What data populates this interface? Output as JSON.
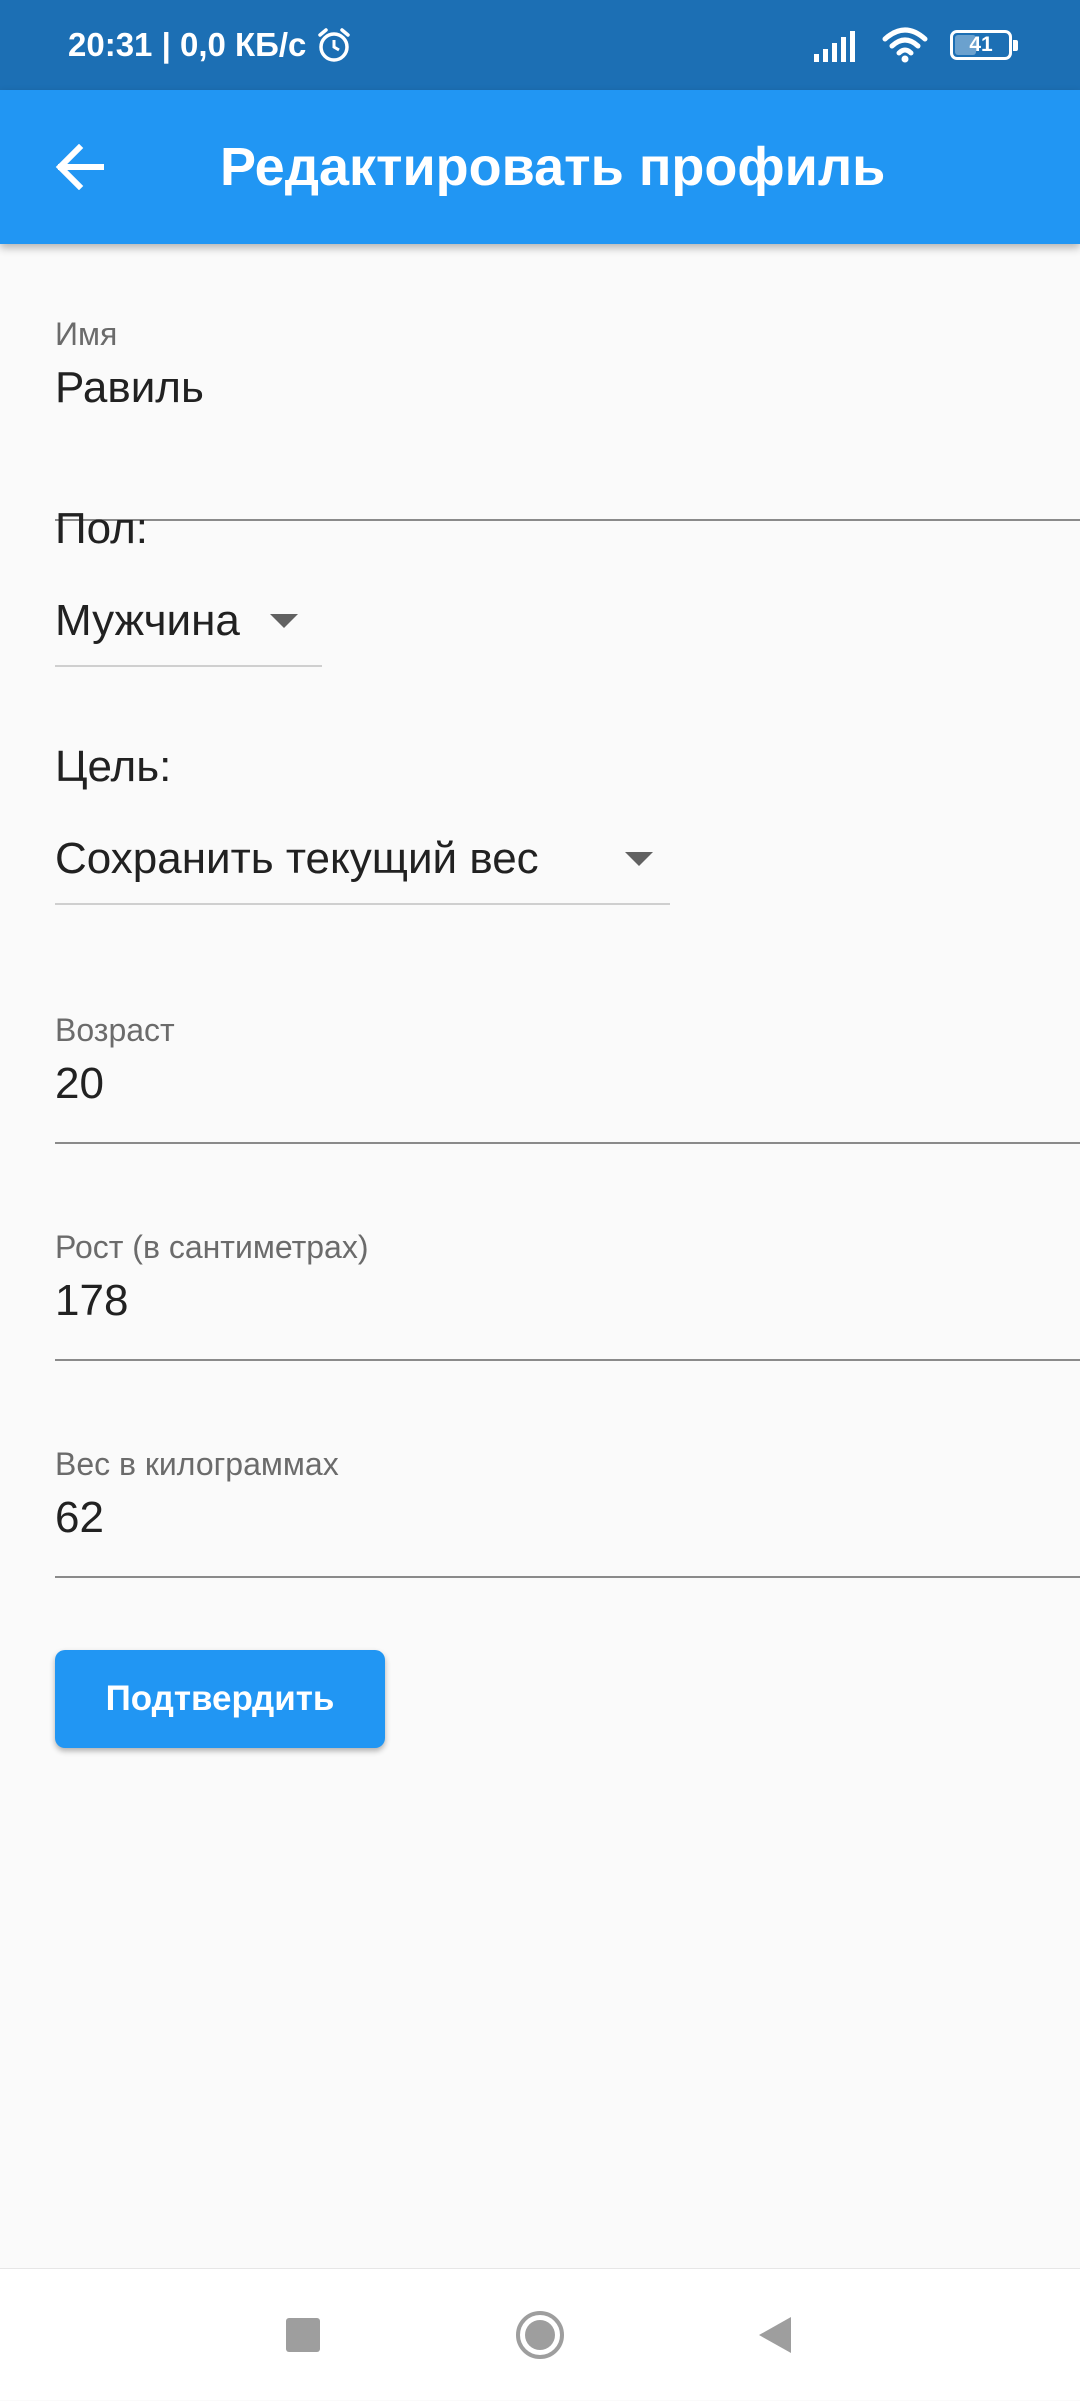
{
  "status_bar": {
    "time_speed": "20:31 | 0,0 КБ/с",
    "battery_level": "41",
    "battery_fraction": 0.41,
    "icons": [
      "alarm-icon",
      "signal-icon",
      "wifi-icon",
      "battery-icon"
    ]
  },
  "app_bar": {
    "title": "Редактировать профиль",
    "back_icon": "arrow-back-icon",
    "color": "#2196f3"
  },
  "form": {
    "name": {
      "label": "Имя",
      "value": "Равиль"
    },
    "gender": {
      "label": "Пол:",
      "value": "Мужчина"
    },
    "goal": {
      "label": "Цель:",
      "value": "Сохранить текущий вес"
    },
    "age": {
      "label": "Возраст",
      "value": "20"
    },
    "height": {
      "label": "Рост (в сантиметрах)",
      "value": "178"
    },
    "weight": {
      "label": "Вес в килограммах",
      "value": "62"
    },
    "submit_label": "Подтвердить"
  },
  "nav_bar": {
    "icons": [
      "recents-square-icon",
      "home-circle-icon",
      "back-triangle-icon"
    ]
  },
  "colors": {
    "status_bar": "#1c6fb4",
    "accent": "#2196f3",
    "background": "#fafafa"
  }
}
